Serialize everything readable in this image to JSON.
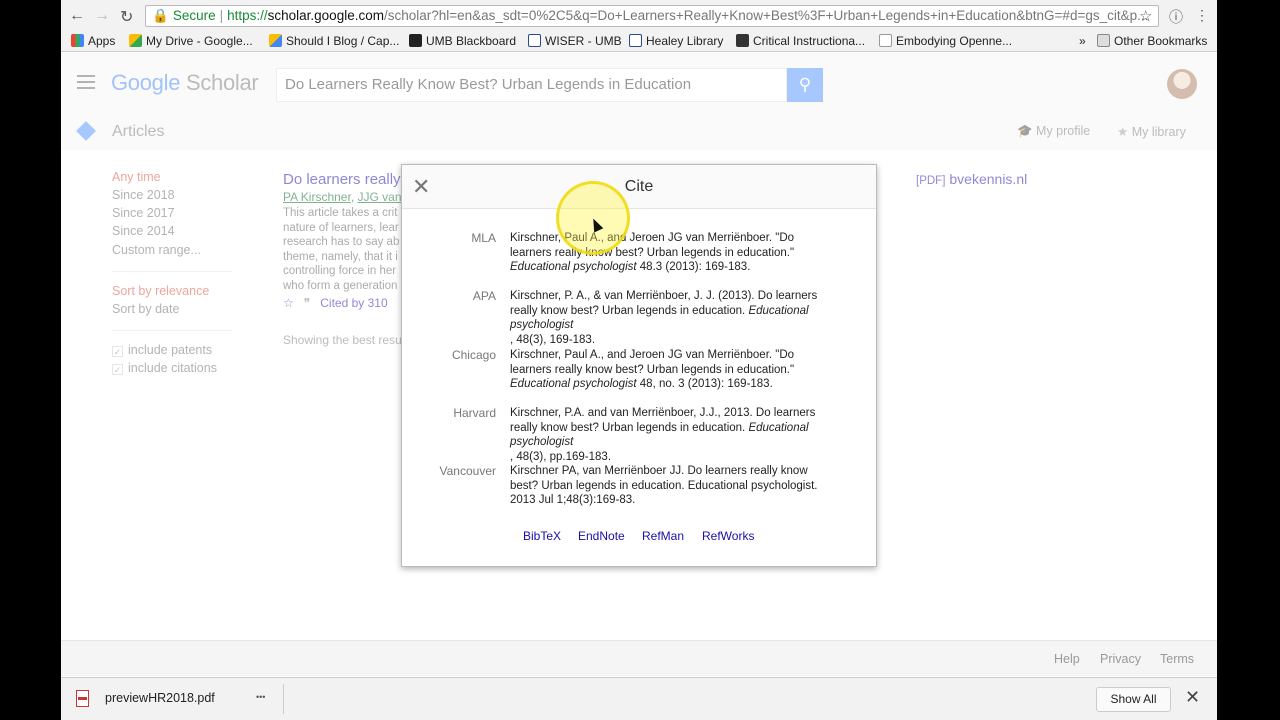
{
  "browser": {
    "secure_label": "Secure",
    "url_proto": "https://",
    "url_host": "scholar.google.com",
    "url_path": "/scholar?hl=en&as_sdt=0%2C5&q=Do+Learners+Really+Know+Best%3F+Urban+Legends+in+Education&btnG=#d=gs_cit&p...",
    "bookmarks": [
      "Apps",
      "My Drive - Google...",
      "Should I Blog / Cap...",
      "UMB Blackboard",
      "WISER - UMB",
      "Healey Library",
      "Critical Instructiona...",
      "Embodying Openne..."
    ],
    "bookmarks_more": "»",
    "other_bookmarks": "Other Bookmarks"
  },
  "header": {
    "logo_google": "Google",
    "logo_scholar": "Scholar",
    "search_value": "Do Learners Really Know Best? Urban Legends in Education",
    "articles_label": "Articles",
    "my_profile": "My profile",
    "my_library": "My library"
  },
  "sidebar": {
    "time": [
      "Any time",
      "Since 2018",
      "Since 2017",
      "Since 2014",
      "Custom range..."
    ],
    "sort": [
      "Sort by relevance",
      "Sort by date"
    ],
    "checks": [
      "include patents",
      "include citations"
    ]
  },
  "result": {
    "title": "Do learners really",
    "author1": "PA Kirschner",
    "author2": "JJG van",
    "snippet": [
      "This article takes a crit",
      "nature of learners, lear",
      "research has to say ab",
      "theme, namely, that it i",
      "controlling force in her",
      "who form a generation"
    ],
    "cited_by": "Cited by 310",
    "note": "Showing the best resu",
    "pdf_tag": "[PDF]",
    "pdf_host": "bvekennis.nl"
  },
  "modal": {
    "title": "Cite",
    "close": "✕",
    "citations": [
      {
        "style": "MLA",
        "lines": [
          "Kirschner, Paul A., and Jeroen JG van Merriënboer. \"Do",
          "learners really know best? Urban legends in education.\""
        ],
        "journal": "Educational psychologist",
        "rest": " 48.3 (2013): 169-183."
      },
      {
        "style": "APA",
        "lines": [
          "Kirschner, P. A., & van Merriënboer, J. J. (2013). Do learners",
          "really know best? Urban legends in education. "
        ],
        "journal": "Educational psychologist",
        "rest": ", 48(3), 169-183."
      },
      {
        "style": "Chicago",
        "lines": [
          "Kirschner, Paul A., and Jeroen JG van Merriënboer. \"Do",
          "learners really know best? Urban legends in education.\""
        ],
        "journal": "Educational psychologist",
        "rest": " 48, no. 3 (2013): 169-183."
      },
      {
        "style": "Harvard",
        "lines": [
          "Kirschner, P.A. and van Merriënboer, J.J., 2013. Do learners",
          "really know best? Urban legends in education. "
        ],
        "journal": "Educational psychologist",
        "rest": ", 48(3), pp.169-183."
      },
      {
        "style": "Vancouver",
        "lines": [
          "Kirschner PA, van Merriënboer JJ. Do learners really know",
          "best? Urban legends in education. Educational psychologist."
        ],
        "journal": "",
        "rest": "2013 Jul 1;48(3):169-83."
      }
    ],
    "exports": [
      "BibTeX",
      "EndNote",
      "RefMan",
      "RefWorks"
    ]
  },
  "footer": [
    "Help",
    "Privacy",
    "Terms"
  ],
  "downloads": {
    "file": "previewHR2018.pdf",
    "more": "•••",
    "show_all": "Show All",
    "close": "✕"
  }
}
